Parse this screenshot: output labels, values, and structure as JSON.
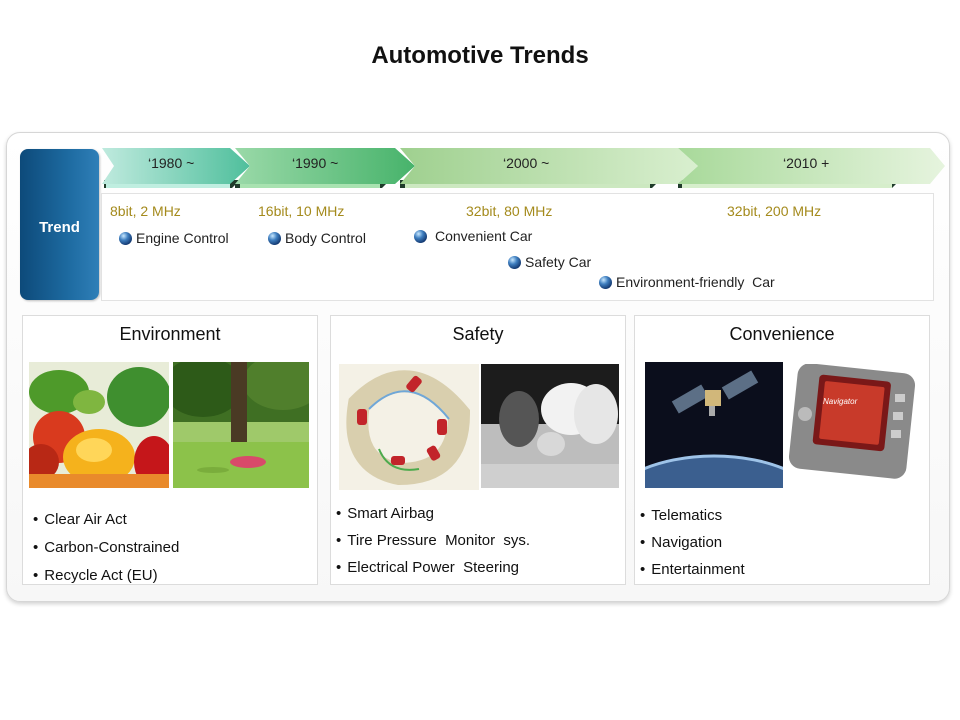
{
  "title": "Automotive Trends",
  "trend_label": "Trend",
  "eras": [
    "‘1980 ~",
    "‘1990 ~",
    "‘2000 ~",
    "‘2010 +"
  ],
  "bit_specs": [
    "8bit, 2 MHz",
    "16bit, 10 MHz",
    "32bit, 80 MHz",
    "32bit, 200 MHz"
  ],
  "applications": [
    "Engine Control",
    "Body Control",
    "Convenient Car",
    "Safety Car",
    "Environment-friendly  Car"
  ],
  "panels": {
    "environment": {
      "title": "Environment",
      "bullets": [
        "Clear Air Act",
        "Carbon-Constrained",
        "Recycle Act (EU)"
      ],
      "images": [
        "vegetables-image",
        "tree-park-image"
      ]
    },
    "safety": {
      "title": "Safety",
      "bullets": [
        "Smart Airbag",
        "Tire Pressure  Monitor  sys.",
        "Electrical Power  Steering"
      ],
      "images": [
        "vehicle-stability-image",
        "airbag-image"
      ]
    },
    "convenience": {
      "title": "Convenience",
      "bullets": [
        "Telematics",
        "Navigation",
        "Entertainment"
      ],
      "images": [
        "satellite-image",
        "navigator-device-image"
      ],
      "device_screen_text": "Navigator"
    }
  },
  "colors": {
    "accent_blue": "#1d6aa0",
    "arrow_teal": "#5fc4a8",
    "arrow_green": "#6ab86a",
    "bit_text_gold": "#a48a1c"
  }
}
